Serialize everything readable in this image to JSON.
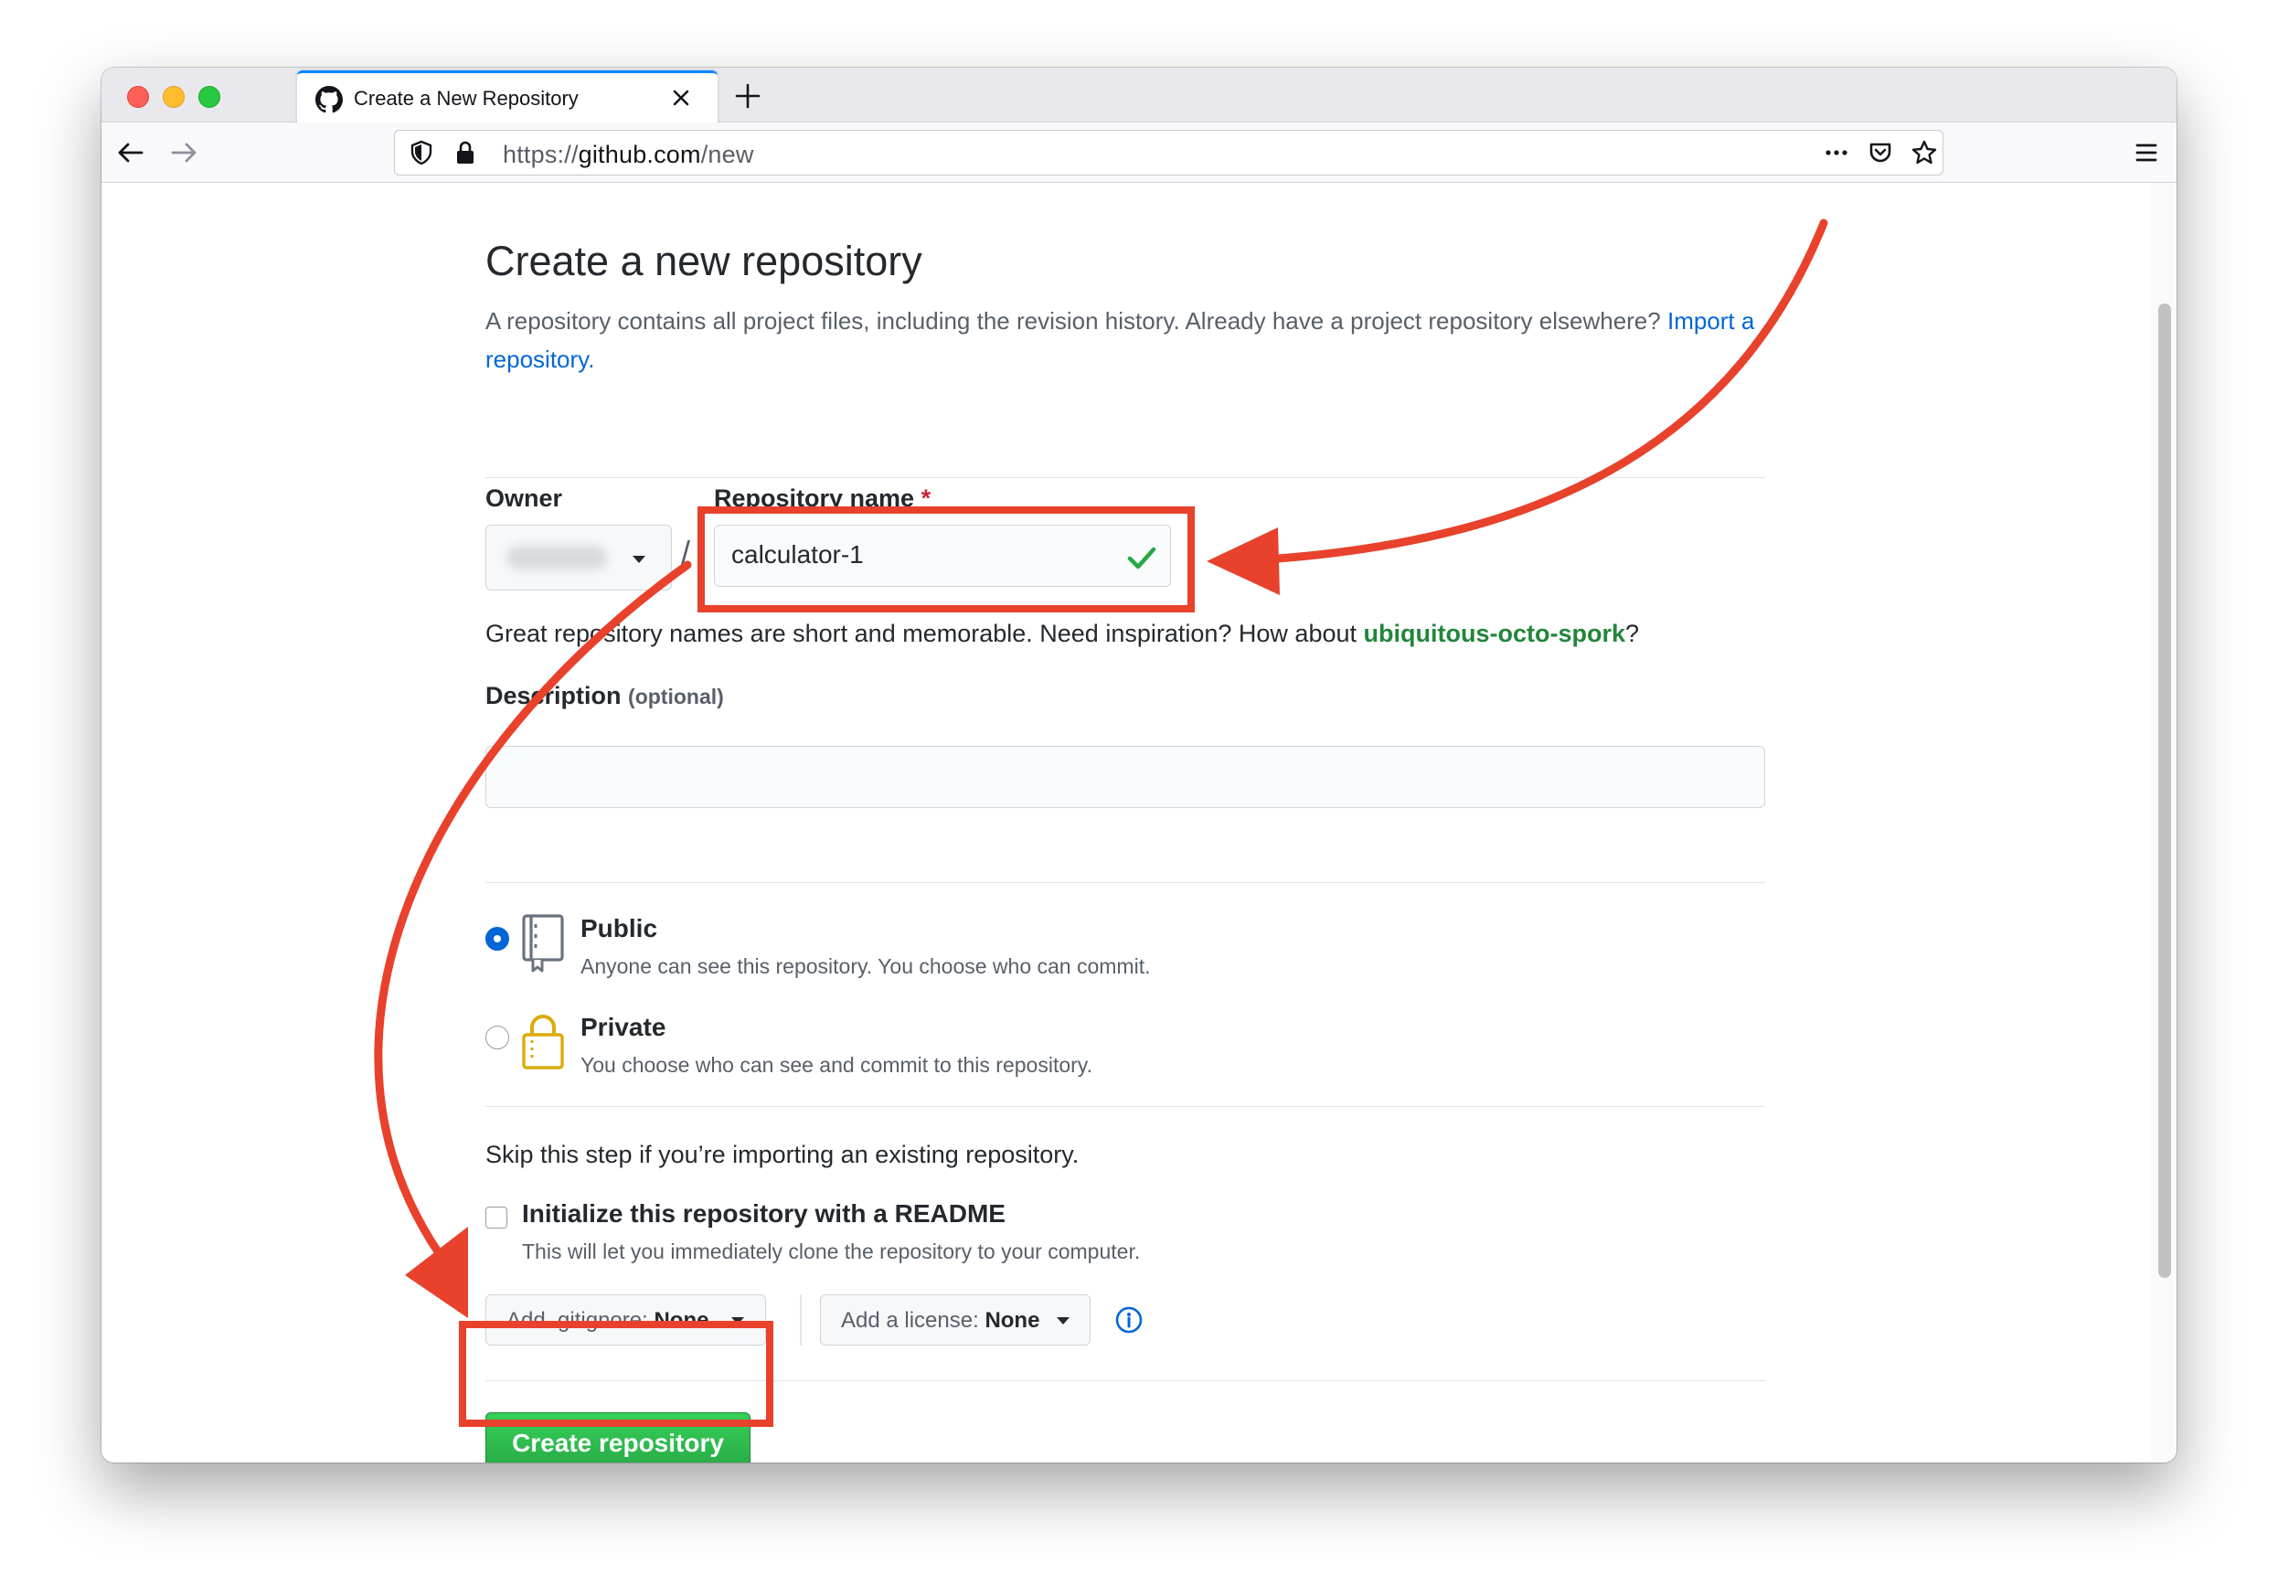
{
  "browser": {
    "tab_title": "Create a New Repository",
    "url_scheme": "https://",
    "url_host": "github.com",
    "url_path": "/new"
  },
  "page": {
    "title": "Create a new repository",
    "subtitle": "A repository contains all project files, including the revision history. Already have a project repository elsewhere?",
    "import_link": "Import a repository."
  },
  "form": {
    "owner_label": "Owner",
    "repo_name_label": "Repository name",
    "required_mark": "*",
    "slash": "/",
    "repo_name_value": "calculator-1",
    "hint_prefix": "Great repository names are short and memorable. Need inspiration? How about",
    "hint_suggestion": "ubiquitous-octo-spork",
    "hint_suffix": "?",
    "description_label": "Description",
    "description_optional": "(optional)",
    "description_value": ""
  },
  "visibility": {
    "public_title": "Public",
    "public_desc": "Anyone can see this repository. You choose who can commit.",
    "public_selected": true,
    "private_title": "Private",
    "private_desc": "You choose who can see and commit to this repository.",
    "private_selected": false
  },
  "init": {
    "skip_text": "Skip this step if you’re importing an existing repository.",
    "readme_label": "Initialize this repository with a README",
    "readme_desc": "This will let you immediately clone the repository to your computer.",
    "readme_checked": false,
    "gitignore_label": "Add .gitignore:",
    "gitignore_value": "None",
    "license_label": "Add a license:",
    "license_value": "None"
  },
  "actions": {
    "create_button": "Create repository"
  },
  "badge": "normal",
  "colors": {
    "annotation": "#e8412c",
    "primary_green": "#28a745",
    "link_blue": "#0366d6",
    "suggestion_green": "#22863a"
  },
  "icons": [
    "github-icon",
    "close-icon",
    "plus-icon",
    "back-arrow-icon",
    "forward-arrow-icon",
    "shield-icon",
    "lock-icon",
    "more-icon",
    "pocket-icon",
    "star-icon",
    "hamburger-menu-icon",
    "checkmark-icon",
    "repo-book-icon",
    "padlock-icon",
    "info-icon"
  ]
}
